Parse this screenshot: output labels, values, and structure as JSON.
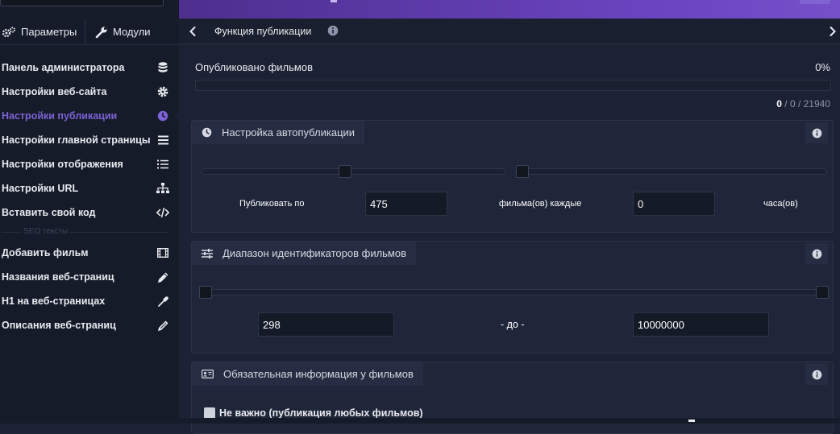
{
  "sidebar": {
    "tabs": [
      {
        "label": "Параметры",
        "icon": "gears-icon"
      },
      {
        "label": "Модули",
        "icon": "wrench-icon"
      }
    ],
    "items": [
      {
        "label": "Панель администратора",
        "icon": "database-icon"
      },
      {
        "label": "Настройки веб-сайта",
        "icon": "gear-icon"
      },
      {
        "label": "Настройки публикации",
        "icon": "clock-icon",
        "active": true
      },
      {
        "label": "Настройки главной страницы",
        "icon": "list-icon"
      },
      {
        "label": "Настройки отображения",
        "icon": "list-bullets-icon"
      },
      {
        "label": "Настройки URL",
        "icon": "sitemap-icon"
      },
      {
        "label": "Вставить свой код",
        "icon": "code-icon"
      }
    ],
    "section_label": "SEO тексты",
    "seo_items": [
      {
        "label": "Добавить фильм",
        "icon": "film-icon"
      },
      {
        "label": "Названия веб-страниц",
        "icon": "pencil-icon"
      },
      {
        "label": "H1 на веб-страницах",
        "icon": "eyedropper-icon"
      },
      {
        "label": "Описания веб-страниц",
        "icon": "pen-square-icon"
      }
    ]
  },
  "header": {
    "title": "Функция публикации"
  },
  "publication": {
    "label": "Опубликовано фильмов",
    "percent_text": "0%",
    "progress": 0,
    "published": "0",
    "counts_rest": " / 0 / 21940"
  },
  "autopublish": {
    "title": "Настройка автопубликации",
    "publish_label": "Публиковать по",
    "count_value": "475",
    "films_label": "фильма(ов) каждые",
    "hours_value": "0",
    "hours_label": "часа(ов)"
  },
  "id_range": {
    "title": "Диапазон идентификаторов фильмов",
    "from_value": "298",
    "to_label": "- до -",
    "to_value": "10000000"
  },
  "required_info": {
    "title": "Обязательная информация у фильмов",
    "option_label": "Не важно (публикация любых фильмов)"
  },
  "colors": {
    "accent": "#7b63d6",
    "header_gradient_start": "#4d2f8e",
    "header_gradient_end": "#7550c9",
    "background": "#1c2234",
    "sidebar": "#161b29"
  }
}
